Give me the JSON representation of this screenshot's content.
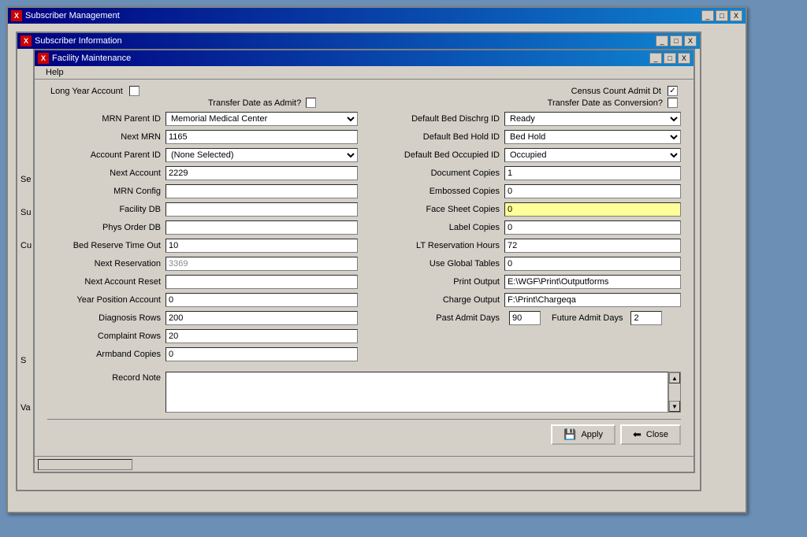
{
  "windows": {
    "subscriber_mgmt": {
      "title": "Subscriber Management",
      "controls": [
        "_",
        "□",
        "X"
      ]
    },
    "subscriber_info": {
      "title": "Subscriber Information",
      "controls": [
        "_",
        "□",
        "X"
      ]
    },
    "facility": {
      "title": "Facility Maintenance",
      "controls": [
        "_",
        "□",
        "X"
      ]
    }
  },
  "menu": {
    "help": "Help"
  },
  "top_options": {
    "long_year_account_label": "Long Year Account",
    "long_year_account_checked": false,
    "census_count_admit_dt_label": "Census Count Admit Dt",
    "census_count_admit_dt_checked": true,
    "transfer_date_as_admit_label": "Transfer Date as Admit?",
    "transfer_date_as_admit_checked": false,
    "transfer_date_as_conversion_label": "Transfer Date as Conversion?",
    "transfer_date_as_conversion_checked": false
  },
  "left_fields": {
    "mrn_parent_id": {
      "label": "MRN Parent ID",
      "value": "Memorial Medical Center",
      "type": "select"
    },
    "next_mrn": {
      "label": "Next MRN",
      "value": "1165"
    },
    "account_parent_id": {
      "label": "Account Parent ID",
      "value": "(None Selected)",
      "type": "select"
    },
    "next_account": {
      "label": "Next Account",
      "value": "2229"
    },
    "mrn_config": {
      "label": "MRN Config",
      "value": ""
    },
    "facility_db": {
      "label": "Facility DB",
      "value": ""
    },
    "phys_order_db": {
      "label": "Phys Order DB",
      "value": ""
    },
    "bed_reserve_time_out": {
      "label": "Bed Reserve Time Out",
      "value": "10"
    },
    "next_reservation": {
      "label": "Next Reservation",
      "value": "3369",
      "readonly": true
    },
    "next_account_reset": {
      "label": "Next Account Reset",
      "value": ""
    },
    "year_position_account": {
      "label": "Year Position Account",
      "value": "0"
    },
    "diagnosis_rows": {
      "label": "Diagnosis Rows",
      "value": "200"
    },
    "complaint_rows": {
      "label": "Complaint Rows",
      "value": "20"
    },
    "armband_copies": {
      "label": "Armband Copies",
      "value": "0"
    }
  },
  "right_fields": {
    "default_bed_dischrg_id": {
      "label": "Default Bed Dischrg ID",
      "value": "Ready",
      "type": "select"
    },
    "default_bed_hold_id": {
      "label": "Default Bed Hold ID",
      "value": "Bed Hold",
      "type": "select"
    },
    "default_bed_occupied_id": {
      "label": "Default Bed Occupied ID",
      "value": "Occupied",
      "type": "select"
    },
    "document_copies": {
      "label": "Document Copies",
      "value": "1"
    },
    "embossed_copies": {
      "label": "Embossed Copies",
      "value": "0"
    },
    "face_sheet_copies": {
      "label": "Face Sheet Copies",
      "value": "0",
      "highlight": true
    },
    "label_copies": {
      "label": "Label Copies",
      "value": "0"
    },
    "lt_reservation_hours": {
      "label": "LT Reservation Hours",
      "value": "72"
    },
    "use_global_tables": {
      "label": "Use Global Tables",
      "value": "0"
    },
    "print_output": {
      "label": "Print Output",
      "value": "E:\\WGF\\Print\\Outputforms"
    },
    "charge_output": {
      "label": "Charge Output",
      "value": "F:\\Print\\Chargeqa"
    },
    "past_admit_days": {
      "label": "Past Admit Days",
      "value": "90"
    },
    "future_admit_days": {
      "label": "Future Admit Days",
      "value": "2"
    }
  },
  "record_note": {
    "label": "Record Note",
    "value": ""
  },
  "buttons": {
    "apply": "Apply",
    "close": "Close"
  },
  "sidebar_items": {
    "se": "Se",
    "su": "Su",
    "cu": "Cu",
    "s": "S",
    "va": "Va"
  }
}
